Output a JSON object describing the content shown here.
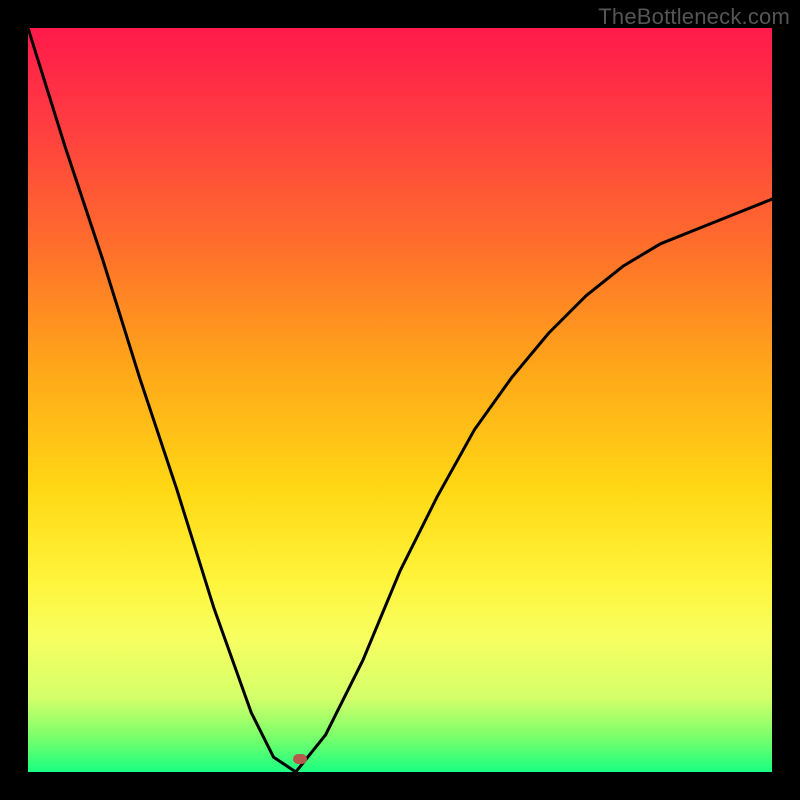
{
  "attribution": "TheBottleneck.com",
  "chart_data": {
    "type": "line",
    "title": "",
    "xlabel": "",
    "ylabel": "",
    "xlim": [
      0,
      1
    ],
    "ylim": [
      0,
      1
    ],
    "series": [
      {
        "name": "bottleneck-curve",
        "x": [
          0.0,
          0.05,
          0.1,
          0.15,
          0.2,
          0.25,
          0.3,
          0.33,
          0.36,
          0.4,
          0.45,
          0.5,
          0.55,
          0.6,
          0.65,
          0.7,
          0.75,
          0.8,
          0.85,
          0.9,
          0.95,
          1.0
        ],
        "y": [
          1.0,
          0.84,
          0.69,
          0.53,
          0.38,
          0.22,
          0.08,
          0.02,
          0.0,
          0.05,
          0.15,
          0.27,
          0.37,
          0.46,
          0.53,
          0.59,
          0.64,
          0.68,
          0.71,
          0.73,
          0.75,
          0.77
        ]
      }
    ],
    "marker": {
      "x": 0.365,
      "y": 0.018
    },
    "gradient_stops": [
      {
        "pos": 0.0,
        "color": "#ff1a4b"
      },
      {
        "pos": 0.12,
        "color": "#ff3a42"
      },
      {
        "pos": 0.28,
        "color": "#ff6a2d"
      },
      {
        "pos": 0.45,
        "color": "#ffa41a"
      },
      {
        "pos": 0.62,
        "color": "#ffd814"
      },
      {
        "pos": 0.74,
        "color": "#fff43a"
      },
      {
        "pos": 0.82,
        "color": "#f7ff60"
      },
      {
        "pos": 0.9,
        "color": "#d4ff6a"
      },
      {
        "pos": 0.95,
        "color": "#7fff6a"
      },
      {
        "pos": 1.0,
        "color": "#1aff80"
      }
    ]
  }
}
